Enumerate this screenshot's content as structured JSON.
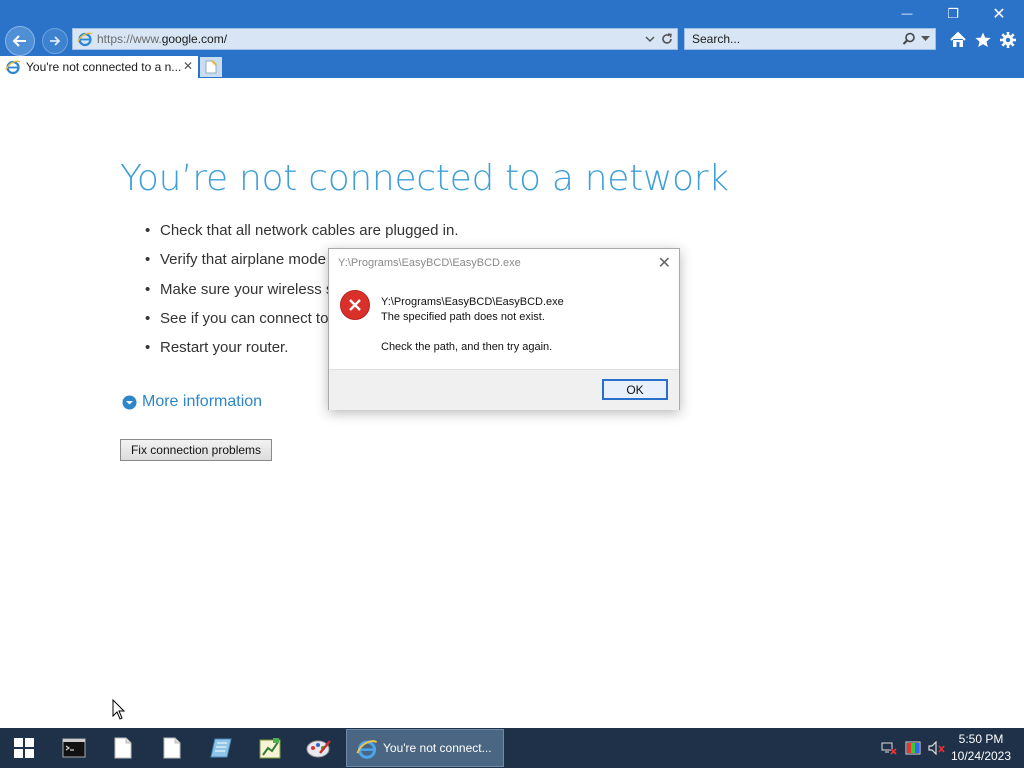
{
  "browser": {
    "url_prefix": "https://www.",
    "url_domain": "google.com/",
    "search_placeholder": "Search...",
    "tab_title": "You're not connected to a n...",
    "icons": [
      "back-icon",
      "forward-icon",
      "ie-icon",
      "dropdown-icon",
      "refresh-icon",
      "search-icon",
      "home-icon",
      "favorites-star-icon",
      "settings-gear-icon"
    ],
    "window_controls": {
      "minimize": "—",
      "restore": "❐",
      "close": "✕"
    },
    "tab_close": "✕"
  },
  "page": {
    "title": "You’re not connected to a network",
    "bullets": [
      "Check that all network cables are plugged in.",
      "Verify that airplane mode",
      "Make sure your wireless s",
      "See if you can connect to",
      "Restart your router."
    ],
    "more_info": "More information",
    "fix_button": "Fix connection problems"
  },
  "dialog": {
    "title": "Y:\\Programs\\EasyBCD\\EasyBCD.exe",
    "close": "✕",
    "line1": "Y:\\Programs\\EasyBCD\\EasyBCD.exe",
    "line2": "The specified path does not exist.",
    "line3": "Check the path, and then try again.",
    "ok": "OK"
  },
  "taskbar": {
    "ie_label": "You're not connect...",
    "time": "5:50 PM",
    "date": "10/24/2023",
    "pinned_icons": [
      "start-windows-icon",
      "cmd-icon",
      "document-icon",
      "document-icon",
      "notepad-icon",
      "chart-app-icon",
      "paint-icon"
    ],
    "tray_icons": [
      "network-disconnected-icon",
      "color-icon",
      "volume-muted-icon"
    ]
  },
  "colors": {
    "chrome": "#2b73c8",
    "title_blue": "#3f9fd8",
    "taskbar": "#1e3148",
    "error_red": "#d9302a"
  }
}
